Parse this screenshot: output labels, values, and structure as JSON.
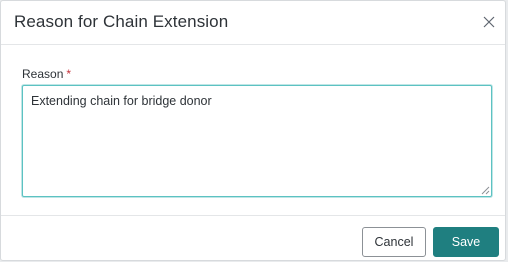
{
  "dialog": {
    "title": "Reason for Chain Extension",
    "close_icon": "close-icon"
  },
  "form": {
    "reason_label": "Reason",
    "required_marker": "*",
    "reason_value": "Extending chain for bridge donor"
  },
  "footer": {
    "cancel_label": "Cancel",
    "save_label": "Save"
  },
  "colors": {
    "primary": "#1f7f80",
    "focus_border": "#5cc2c2",
    "required": "#c5323b"
  }
}
